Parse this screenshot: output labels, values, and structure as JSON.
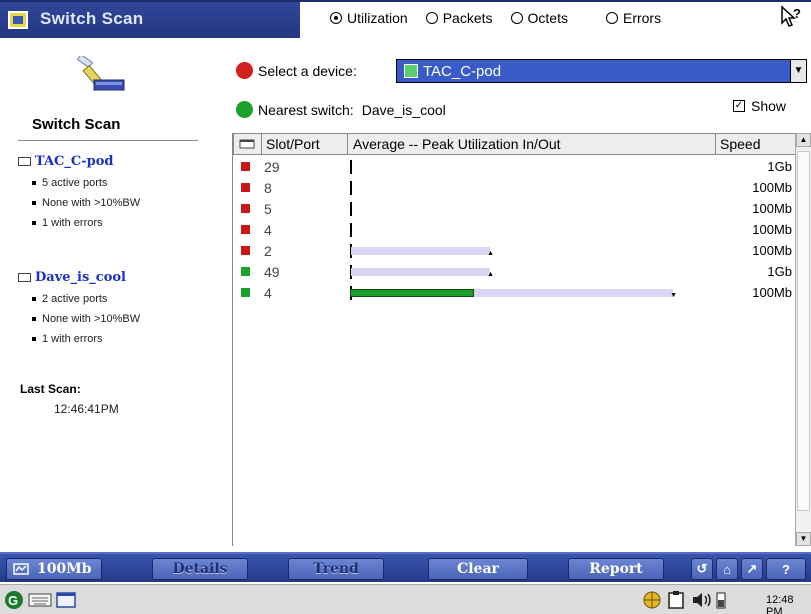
{
  "titlebar": {
    "app_title": "Switch Scan",
    "help_icon": "?"
  },
  "modes": [
    {
      "label": "Utilization",
      "selected": true
    },
    {
      "label": "Packets",
      "selected": false
    },
    {
      "label": "Octets",
      "selected": false
    },
    {
      "label": "Errors",
      "selected": false
    }
  ],
  "left_panel": {
    "title": "Switch Scan",
    "devices": [
      {
        "name": "TAC_C-pod",
        "stats": [
          "5 active ports",
          "None with >10%BW",
          "1 with errors"
        ]
      },
      {
        "name": "Dave_is_cool",
        "stats": [
          "2 active ports",
          "None with >10%BW",
          "1 with errors"
        ]
      }
    ],
    "last_scan_label": "Last Scan:",
    "last_scan_time": "12:46:41PM"
  },
  "device_select": {
    "label": "Select a device:",
    "value": "TAC_C-pod",
    "indicator_color": "#d21f1f"
  },
  "nearest_switch": {
    "label": "Nearest switch:",
    "value": "Dave_is_cool",
    "indicator_color": "#1aa22a"
  },
  "show_checkbox": {
    "label": "Show",
    "checked": true
  },
  "table": {
    "columns": [
      "Slot/Port",
      "Average -- Peak Utilization In/Out",
      "Speed"
    ],
    "rows": [
      {
        "port": "29",
        "speed": "1Gb",
        "status_color": "#c81818",
        "average_pct": 0,
        "peak_pct": 0
      },
      {
        "port": "8",
        "speed": "100Mb",
        "status_color": "#c81818",
        "average_pct": 0,
        "peak_pct": 0
      },
      {
        "port": "5",
        "speed": "100Mb",
        "status_color": "#c81818",
        "average_pct": 0,
        "peak_pct": 0
      },
      {
        "port": "4",
        "speed": "100Mb",
        "status_color": "#c81818",
        "average_pct": 0,
        "peak_pct": 0
      },
      {
        "port": "2",
        "speed": "100Mb",
        "status_color": "#c81818",
        "average_pct": 0,
        "peak_pct": 38
      },
      {
        "port": "49",
        "speed": "1Gb",
        "status_color": "#1aa22a",
        "average_pct": 0,
        "peak_pct": 38
      },
      {
        "port": "4",
        "speed": "100Mb",
        "status_color": "#1aa22a",
        "average_pct": 34,
        "peak_pct": 88
      }
    ]
  },
  "toolbar": {
    "speed_label": "100Mb",
    "details_label": "Details",
    "trend_label": "Trend",
    "clear_label": "Clear",
    "report_label": "Report"
  },
  "taskbar": {
    "clock": "12:48 PM"
  },
  "colors": {
    "title_blue": "#23377f",
    "select_blue": "#3a5bc7",
    "device_link": "#1b2fc9"
  }
}
